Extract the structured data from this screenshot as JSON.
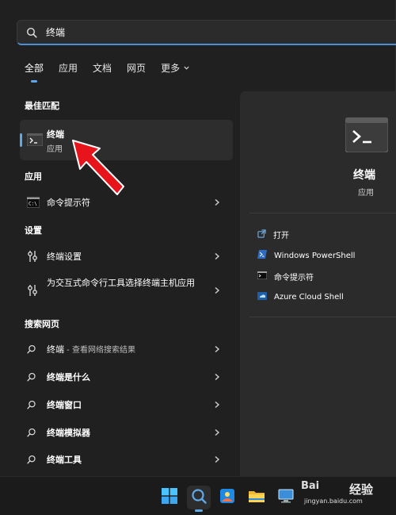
{
  "search": {
    "value": "终端",
    "placeholder": ""
  },
  "tabs": [
    {
      "label": "全部",
      "active": true
    },
    {
      "label": "应用"
    },
    {
      "label": "文档"
    },
    {
      "label": "网页"
    },
    {
      "label": "更多"
    }
  ],
  "sections": {
    "best_match": "最佳匹配",
    "apps": "应用",
    "settings": "设置",
    "web": "搜索网页"
  },
  "best_match": {
    "name": "终端",
    "type": "应用",
    "icon": "terminal-icon"
  },
  "apps": [
    {
      "label": "命令提示符",
      "icon": "command-prompt-icon"
    }
  ],
  "settings": [
    {
      "label": "终端设置",
      "icon": "settings-sliders-icon"
    },
    {
      "label": "为交互式命令行工具选择终端主机应用",
      "icon": "settings-sliders-icon"
    }
  ],
  "web": [
    {
      "label": "终端",
      "suffix": " - 查看网络搜索结果",
      "icon": "search-icon"
    },
    {
      "label": "终端是什么",
      "icon": "search-icon"
    },
    {
      "label": "终端窗口",
      "icon": "search-icon"
    },
    {
      "label": "终端模拟器",
      "icon": "search-icon"
    },
    {
      "label": "终端工具",
      "icon": "search-icon"
    }
  ],
  "details": {
    "title": "终端",
    "type": "应用",
    "actions": [
      {
        "label": "打开",
        "icon": "open-external-icon"
      },
      {
        "label": "Windows PowerShell",
        "icon": "powershell-icon"
      },
      {
        "label": "命令提示符",
        "icon": "command-prompt-icon"
      },
      {
        "label": "Azure Cloud Shell",
        "icon": "azure-cloud-shell-icon"
      }
    ]
  },
  "taskbar": [
    {
      "name": "start-button",
      "icon": "windows-logo-icon"
    },
    {
      "name": "search-button",
      "icon": "search-icon",
      "active": true
    },
    {
      "name": "photos-app",
      "icon": "photos-icon"
    },
    {
      "name": "file-explorer",
      "icon": "folder-icon"
    },
    {
      "name": "remote-desktop",
      "icon": "remote-desktop-icon"
    }
  ],
  "watermark": {
    "brand": "Bai",
    "text": "经验",
    "url": "jingyan.baidu.com"
  },
  "colors": {
    "accent": "#5fa9e8",
    "pointer": "#e8141b",
    "panel": "#202020",
    "details": "#2b2b2b"
  }
}
